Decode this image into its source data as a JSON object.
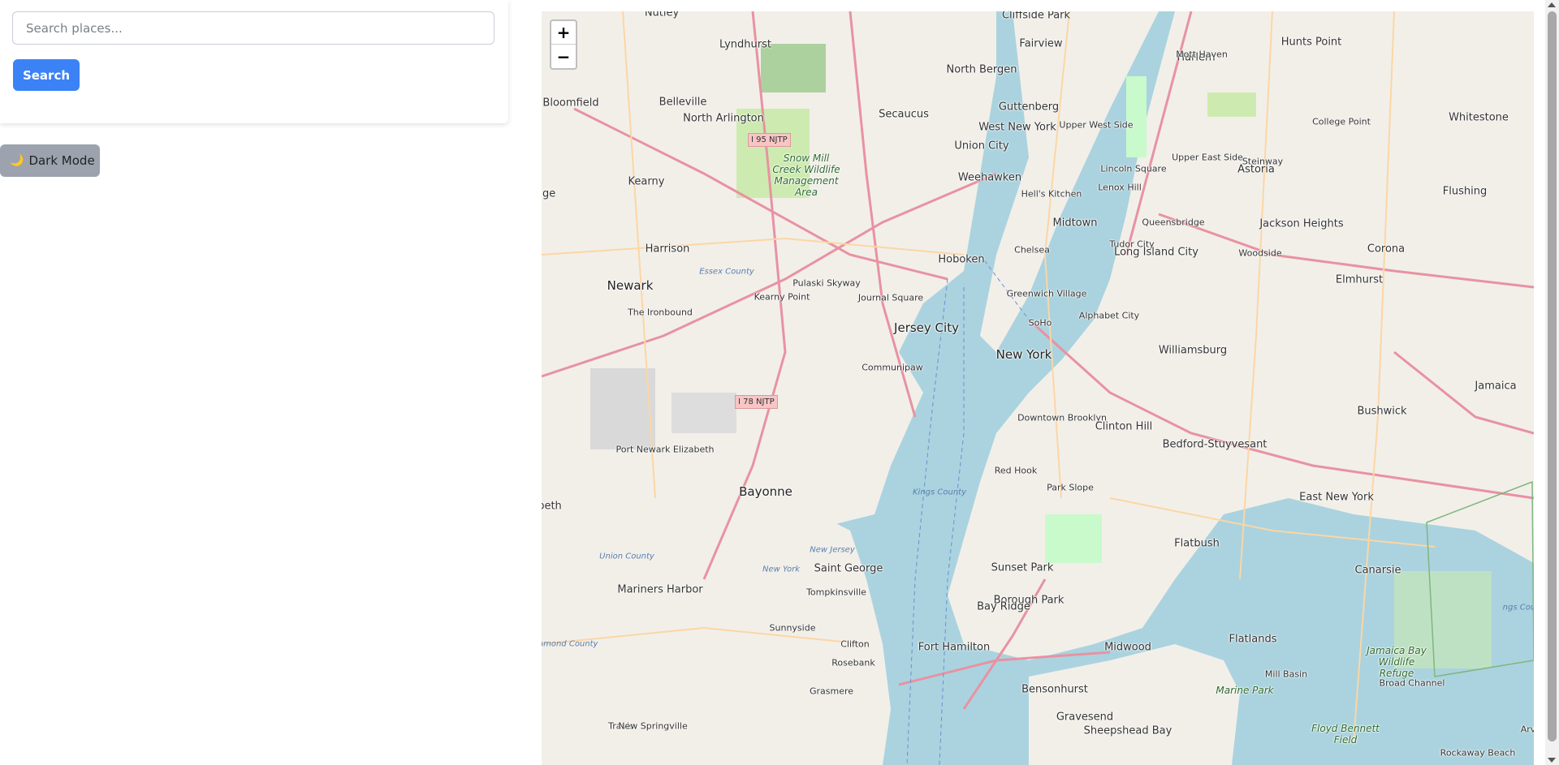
{
  "search": {
    "placeholder": "Search places...",
    "button_label": "Search"
  },
  "dark_mode": {
    "icon": "moon-icon",
    "label": "Dark Mode"
  },
  "map": {
    "zoom_in": "+",
    "zoom_out": "−",
    "labels": [
      {
        "text": "Nutley",
        "cls": "mid"
      },
      {
        "text": "Lyndhurst",
        "cls": "mid"
      },
      {
        "text": "Cliffside Park",
        "cls": "mid"
      },
      {
        "text": "Fairview",
        "cls": "mid"
      },
      {
        "text": "Harlem",
        "cls": "mid"
      },
      {
        "text": "Mott Haven",
        "cls": "small"
      },
      {
        "text": "Hunts Point",
        "cls": "mid"
      },
      {
        "text": "Bloomfield",
        "cls": "mid"
      },
      {
        "text": "Belleville",
        "cls": "mid"
      },
      {
        "text": "North Bergen",
        "cls": "mid"
      },
      {
        "text": "Guttenberg",
        "cls": "mid"
      },
      {
        "text": "College Point",
        "cls": "small"
      },
      {
        "text": "Whitestone",
        "cls": "mid"
      },
      {
        "text": "North Arlington",
        "cls": "mid"
      },
      {
        "text": "Secaucus",
        "cls": "mid"
      },
      {
        "text": "West New York",
        "cls": "mid"
      },
      {
        "text": "Upper West Side",
        "cls": "small"
      },
      {
        "text": "Upper East Side",
        "cls": "small"
      },
      {
        "text": "Union City",
        "cls": "mid"
      },
      {
        "text": "Steinway",
        "cls": "small"
      },
      {
        "text": "Astoria",
        "cls": "mid"
      },
      {
        "text": "Kearny",
        "cls": "mid"
      },
      {
        "text": "Weehawken",
        "cls": "mid"
      },
      {
        "text": "Lincoln Square",
        "cls": "small"
      },
      {
        "text": "Lenox Hill",
        "cls": "small"
      },
      {
        "text": "Hell's Kitchen",
        "cls": "small"
      },
      {
        "text": "Flushing",
        "cls": "mid"
      },
      {
        "text": "Midtown",
        "cls": "mid"
      },
      {
        "text": "Queensbridge",
        "cls": "small"
      },
      {
        "text": "Jackson Heights",
        "cls": "mid"
      },
      {
        "text": "Harrison",
        "cls": "mid"
      },
      {
        "text": "Tudor City",
        "cls": "small"
      },
      {
        "text": "Long Island City",
        "cls": "mid"
      },
      {
        "text": "Chelsea",
        "cls": "small"
      },
      {
        "text": "Woodside",
        "cls": "small"
      },
      {
        "text": "Corona",
        "cls": "mid"
      },
      {
        "text": "Hoboken",
        "cls": "mid"
      },
      {
        "text": "Newark",
        "cls": "big"
      },
      {
        "text": "Pulaski Skyway",
        "cls": "small"
      },
      {
        "text": "Elmhurst",
        "cls": "mid"
      },
      {
        "text": "Greenwich Village",
        "cls": "small"
      },
      {
        "text": "Journal Square",
        "cls": "small"
      },
      {
        "text": "Alphabet City",
        "cls": "small"
      },
      {
        "text": "The Ironbound",
        "cls": "small"
      },
      {
        "text": "Jersey City",
        "cls": "big"
      },
      {
        "text": "SoHo",
        "cls": "small"
      },
      {
        "text": "Williamsburg",
        "cls": "mid"
      },
      {
        "text": "New York",
        "cls": "big"
      },
      {
        "text": "Communipaw",
        "cls": "small"
      },
      {
        "text": "Jamaica",
        "cls": "mid"
      },
      {
        "text": "Bushwick",
        "cls": "mid"
      },
      {
        "text": "Downtown Brooklyn",
        "cls": "small"
      },
      {
        "text": "Clinton Hill",
        "cls": "mid"
      },
      {
        "text": "Port Newark Elizabeth",
        "cls": "small"
      },
      {
        "text": "Bedford-Stuyvesant",
        "cls": "mid"
      },
      {
        "text": "Red Hook",
        "cls": "small"
      },
      {
        "text": "Bayonne",
        "cls": "big"
      },
      {
        "text": "Park Slope",
        "cls": "small"
      },
      {
        "text": "East New York",
        "cls": "mid"
      },
      {
        "text": "Flatbush",
        "cls": "mid"
      },
      {
        "text": "Saint George",
        "cls": "mid"
      },
      {
        "text": "Sunset Park",
        "cls": "mid"
      },
      {
        "text": "Canarsie",
        "cls": "mid"
      },
      {
        "text": "Mariners Harbor",
        "cls": "mid"
      },
      {
        "text": "Tompkinsville",
        "cls": "small"
      },
      {
        "text": "Borough Park",
        "cls": "mid"
      },
      {
        "text": "Bay Ridge",
        "cls": "mid"
      },
      {
        "text": "Sunnyside",
        "cls": "small"
      },
      {
        "text": "Flatlands",
        "cls": "mid"
      },
      {
        "text": "Clifton",
        "cls": "small"
      },
      {
        "text": "Fort Hamilton",
        "cls": "mid"
      },
      {
        "text": "Midwood",
        "cls": "mid"
      },
      {
        "text": "Rosebank",
        "cls": "small"
      },
      {
        "text": "Mill Basin",
        "cls": "small"
      },
      {
        "text": "Broad Channel",
        "cls": "small"
      },
      {
        "text": "Grasmere",
        "cls": "small"
      },
      {
        "text": "Bensonhurst",
        "cls": "mid"
      },
      {
        "text": "Gravesend",
        "cls": "mid"
      },
      {
        "text": "Sheepshead Bay",
        "cls": "mid"
      },
      {
        "text": "Travis",
        "cls": "small"
      },
      {
        "text": "New Springville",
        "cls": "small"
      },
      {
        "text": "Rockaway Beach",
        "cls": "small"
      },
      {
        "text": "Jamaica Bay Wildlife Refuge",
        "cls": "park"
      },
      {
        "text": "Snow Mill Creek Wildlife Management Area",
        "cls": "park"
      },
      {
        "text": "Kearny Point",
        "cls": "small"
      },
      {
        "text": "Essex County",
        "cls": "water"
      },
      {
        "text": "Union County",
        "cls": "water"
      },
      {
        "text": "Kings County",
        "cls": "water"
      },
      {
        "text": "New York",
        "cls": "water"
      },
      {
        "text": "New Jersey",
        "cls": "water"
      },
      {
        "text": "Richmond County",
        "cls": "water"
      },
      {
        "text": "Floyd Bennett Field",
        "cls": "park"
      },
      {
        "text": "Marine Park",
        "cls": "park"
      },
      {
        "text": "ngs County",
        "cls": "water"
      },
      {
        "text": "nge",
        "cls": "mid"
      },
      {
        "text": "beth",
        "cls": "mid"
      },
      {
        "text": "Arv",
        "cls": "small"
      }
    ],
    "shields": [
      "I 95 NJTP",
      "I 78 NJTP"
    ]
  }
}
